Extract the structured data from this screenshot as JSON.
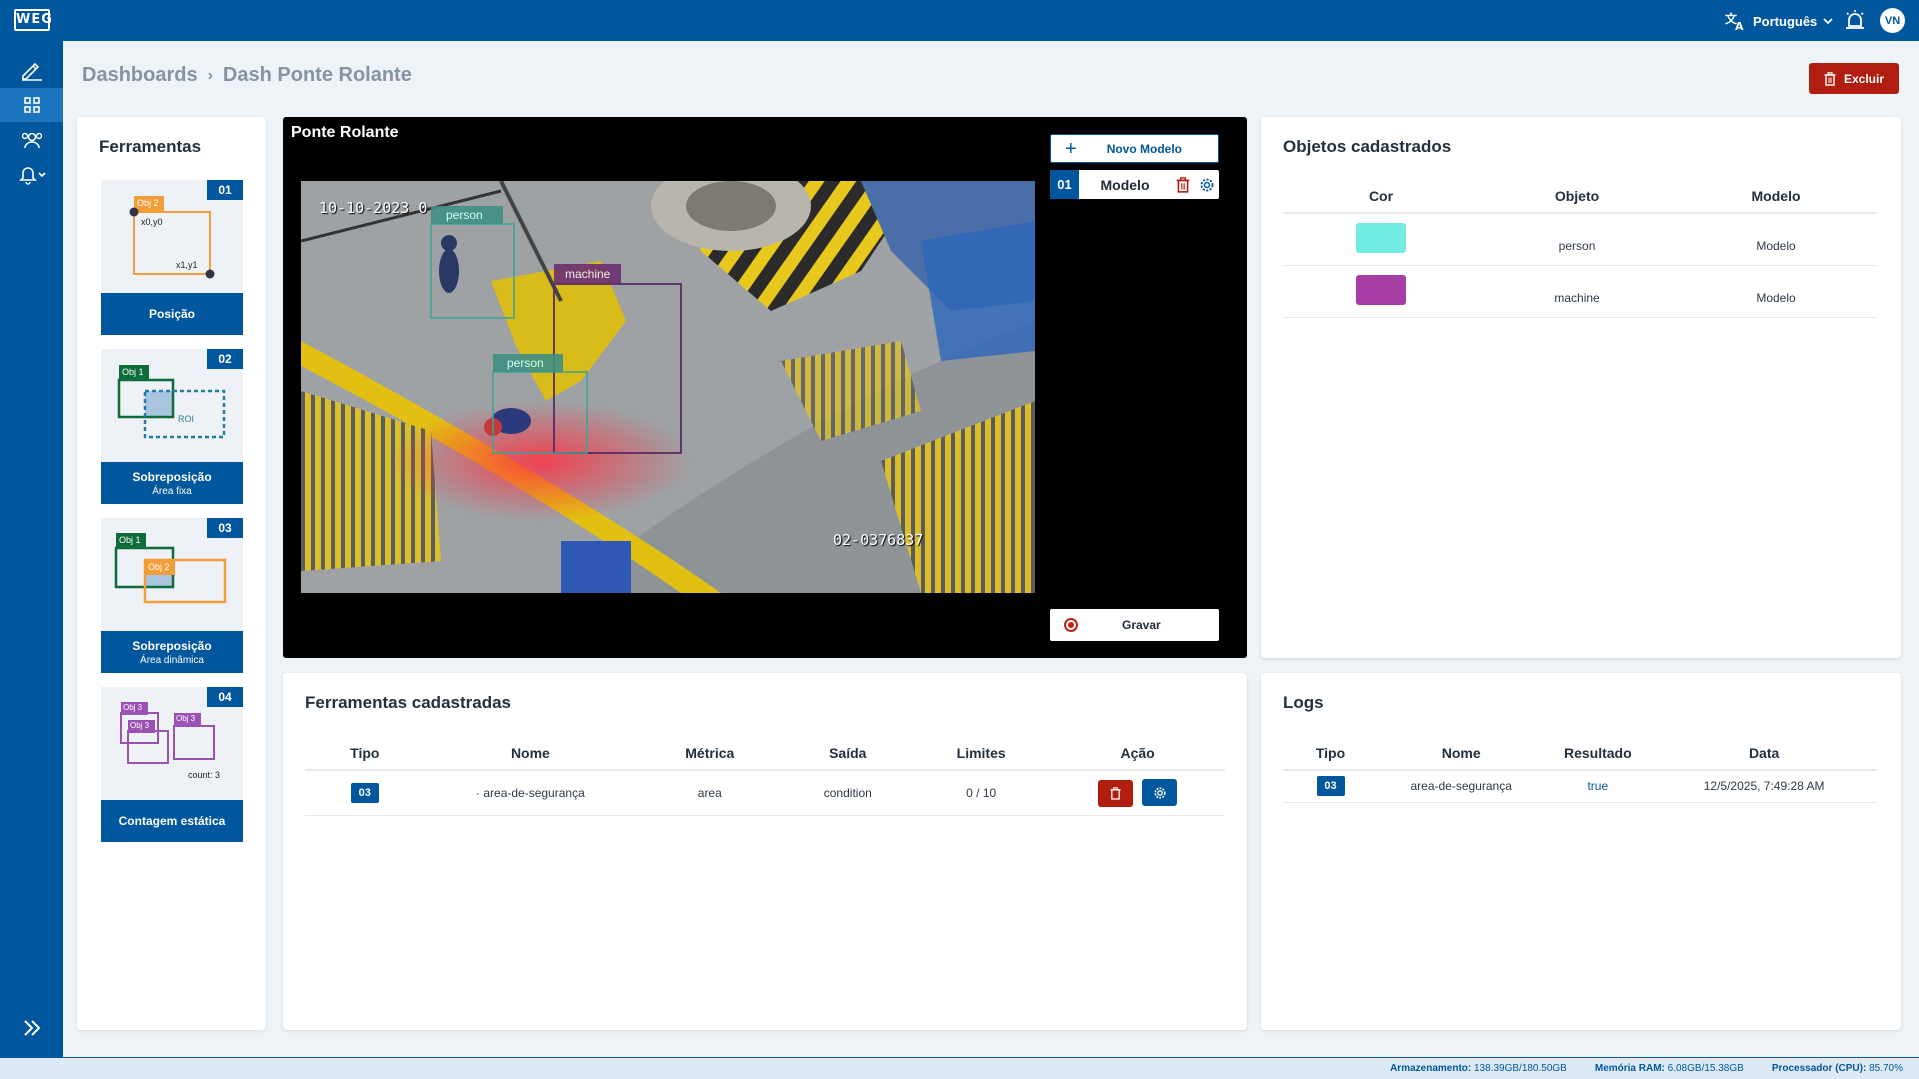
{
  "app": {
    "logo_text": "WEG"
  },
  "topbar": {
    "language": "Português",
    "user_initials": "VN"
  },
  "breadcrumb": {
    "root": "Dashboards",
    "current": "Dash Ponte Rolante"
  },
  "actions": {
    "delete_label": "Excluir"
  },
  "tools_panel": {
    "title": "Ferramentas",
    "tools": [
      {
        "num": "01",
        "label": "Posição",
        "sub": "",
        "img": {
          "a": "Obj 2",
          "b": "x0,y0",
          "c": "x1,y1"
        }
      },
      {
        "num": "02",
        "label": "Sobreposição",
        "sub": "Área fixa",
        "img": {
          "a": "Obj 1",
          "b": "ROI"
        }
      },
      {
        "num": "03",
        "label": "Sobreposição",
        "sub": "Área dinâmica",
        "img": {
          "a": "Obj 1",
          "b": "Obj 2"
        }
      },
      {
        "num": "04",
        "label": "Contagem estática",
        "sub": "",
        "img": {
          "a": "Obj 3",
          "b": "Obj 3",
          "c": "Obj 3",
          "d": "count: 3"
        }
      }
    ]
  },
  "video": {
    "title": "Ponte Rolante",
    "overlay_timestamp": "10-10-2023 0",
    "overlay_camera_id": "02-0376837",
    "detections": [
      {
        "label": "person"
      },
      {
        "label": "machine"
      },
      {
        "label": "person"
      }
    ],
    "new_model_label": "Novo Modelo",
    "model": {
      "num": "01",
      "name": "Modelo"
    },
    "record_label": "Gravar"
  },
  "objects_panel": {
    "title": "Objetos cadastrados",
    "columns": [
      "Cor",
      "Objeto",
      "Modelo"
    ],
    "rows": [
      {
        "color": "#72ece0",
        "object": "person",
        "model": "Modelo"
      },
      {
        "color": "#a63ea6",
        "object": "machine",
        "model": "Modelo"
      }
    ]
  },
  "registered_tools": {
    "title": "Ferramentas cadastradas",
    "columns": [
      "Tipo",
      "Nome",
      "Métrica",
      "Saída",
      "Limites",
      "Ação"
    ],
    "rows": [
      {
        "tipo": "03",
        "nome": "· area-de-segurança",
        "metrica": "area",
        "saida": "condition",
        "limites": "0 / 10"
      }
    ]
  },
  "logs": {
    "title": "Logs",
    "columns": [
      "Tipo",
      "Nome",
      "Resultado",
      "Data"
    ],
    "rows": [
      {
        "tipo": "03",
        "nome": "area-de-segurança",
        "resultado": "true",
        "data": "12/5/2025, 7:49:28 AM"
      }
    ]
  },
  "footer": {
    "storage_label": "Armazenamento:",
    "storage_value": "138.39GB/180.50GB",
    "ram_label": "Memória RAM:",
    "ram_value": "6.08GB/15.38GB",
    "cpu_label": "Processador (CPU):",
    "cpu_value": "85.70%"
  },
  "colors": {
    "brand": "#00579d",
    "danger": "#b11d0e"
  }
}
